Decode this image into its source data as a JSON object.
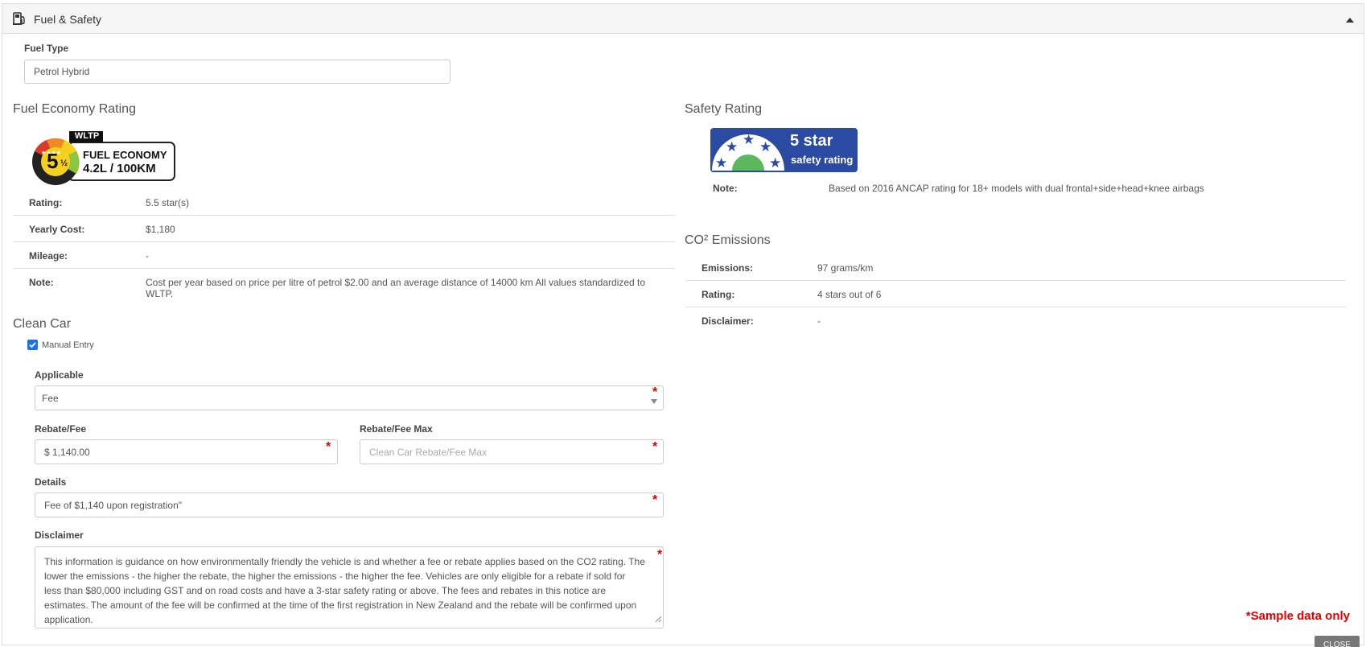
{
  "panel": {
    "title": "Fuel & Safety"
  },
  "fuel_type": {
    "label": "Fuel Type",
    "value": "Petrol Hybrid"
  },
  "fuel_economy": {
    "heading": "Fuel Economy Rating",
    "badge": {
      "tag": "WLTP",
      "line1": "FUEL ECONOMY",
      "line2": "4.2L / 100KM",
      "stars": "5",
      "half": "½"
    },
    "rows": [
      {
        "key": "Rating:",
        "value": "5.5 star(s)"
      },
      {
        "key": "Yearly Cost:",
        "value": "$1,180"
      },
      {
        "key": "Mileage:",
        "value": "-"
      },
      {
        "key": "Note:",
        "value": "Cost per year based on price per litre of petrol $2.00 and an average distance of 14000 km All values standardized to WLTP."
      }
    ]
  },
  "safety": {
    "heading": "Safety Rating",
    "badge": {
      "line1": "5 star",
      "line2": "safety rating"
    },
    "note_key": "Note:",
    "note_value": "Based on 2016 ANCAP rating for 18+ models with dual frontal+side+head+knee airbags"
  },
  "emissions": {
    "heading": "CO² Emissions",
    "rows": [
      {
        "key": "Emissions:",
        "value": "97 grams/km"
      },
      {
        "key": "Rating:",
        "value": "4 stars out of 6"
      },
      {
        "key": "Disclaimer:",
        "value": "-"
      }
    ]
  },
  "clean_car": {
    "heading": "Clean Car",
    "manual_entry": {
      "label": "Manual Entry",
      "checked": true
    },
    "applicable": {
      "label": "Applicable",
      "value": "Fee"
    },
    "rebate_fee": {
      "label": "Rebate/Fee",
      "value": "$ 1,140.00"
    },
    "rebate_fee_max": {
      "label": "Rebate/Fee Max",
      "placeholder": "Clean Car Rebate/Fee Max"
    },
    "details": {
      "label": "Details",
      "value": "Fee of $1,140 upon registration\""
    },
    "disclaimer": {
      "label": "Disclaimer",
      "value": "This information is guidance on how environmentally friendly the vehicle is and whether a fee or rebate applies based on the CO2 rating. The lower the emissions - the higher the rebate, the higher the emissions - the higher the fee. Vehicles are only eligible for a rebate if sold for less than $80,000 including GST and on road costs and have a 3-star safety rating or above. The fees and rebates in this notice are estimates. The amount of the fee will be confirmed at the time of the first registration in New Zealand and the rebate will be confirmed upon application."
    }
  },
  "required_marker": "*",
  "footer": {
    "sample_text": "*Sample data only",
    "close_label": "CLOSE"
  },
  "colors": {
    "safety_blue": "#2b4ba3",
    "required_red": "#dd0000",
    "checkbox_blue": "#1a73e8"
  }
}
